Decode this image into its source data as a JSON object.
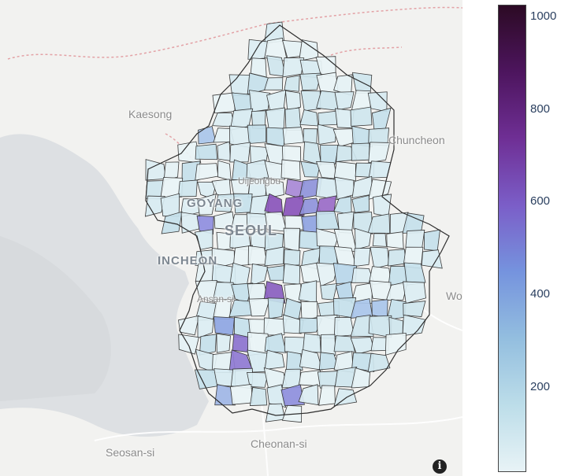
{
  "map": {
    "place_labels": [
      {
        "key": "kaesong",
        "text": "Kaesong"
      },
      {
        "key": "chuncheon",
        "text": "Chuncheon"
      },
      {
        "key": "cheonan",
        "text": "Cheonan-si"
      },
      {
        "key": "seosan",
        "text": "Seosan-si"
      },
      {
        "key": "uijeongbu",
        "text": "Uijeongbu"
      },
      {
        "key": "ansan",
        "text": "Ansan-si"
      },
      {
        "key": "wonju",
        "text": "Wo"
      }
    ],
    "city_labels": [
      {
        "key": "seoul",
        "text": "SEOUL"
      },
      {
        "key": "goyang",
        "text": "GOYANG"
      },
      {
        "key": "incheon",
        "text": "INCHEON"
      }
    ],
    "info_icon": "info-icon"
  },
  "colorbar": {
    "ticks": [
      "1000",
      "800",
      "600",
      "400",
      "200"
    ],
    "tick_values": [
      1000,
      800,
      600,
      400,
      200
    ],
    "min": 0,
    "max": 1030,
    "colors": [
      "#e8f3f6",
      "#bcdde9",
      "#93bedf",
      "#7593de",
      "#7b5ec8",
      "#6f2f95",
      "#4d155e",
      "#2c0a24"
    ]
  }
}
